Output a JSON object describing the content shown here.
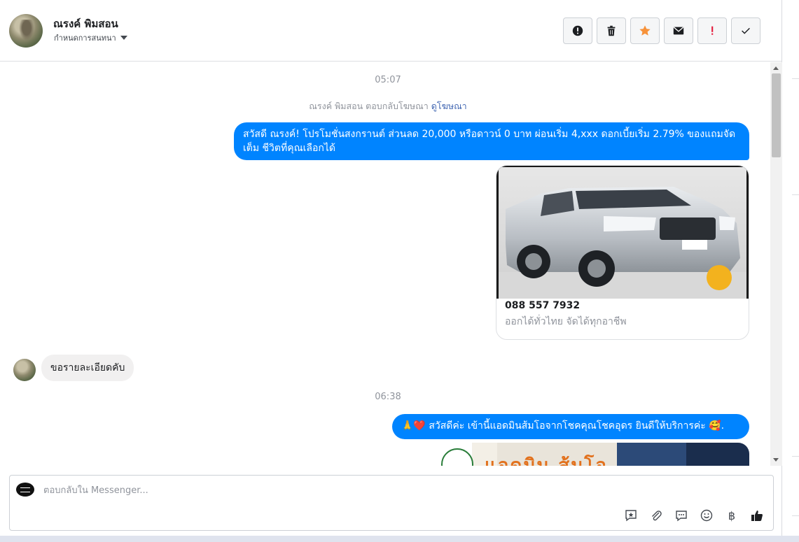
{
  "header": {
    "contact_name": "ณรงค์ พิมสอน",
    "conversation_status": "กำหนดการสนทนา",
    "toolbar_icons": [
      "alert-circle-icon",
      "trash-icon",
      "star-icon",
      "envelope-icon",
      "exclamation-icon",
      "check-icon"
    ]
  },
  "messages": {
    "timestamp_1": "05:07",
    "ad_note_text": "ณรงค์ พิมสอน ตอบกลับโฆษณา",
    "ad_note_link": "ดูโฆษณา",
    "outgoing_1": "สวัสดี ณรงค์! โปรโมชั่นสงกรานต์ ส่วนลด 20,000 หรือดาวน์ 0 บาท ผ่อนเริ่ม 4,xxx ดอกเบี้ยเริ่ม 2.79% ของแถมจัดเต็ม ชีวิตที่คุณเลือกได้",
    "card_phone": "088 557 7932",
    "card_subtitle": "ออกได้ทั่วไทย จัดได้ทุกอาชีพ",
    "incoming_1": "ขอรายละเอียดคับ",
    "timestamp_2": "06:38",
    "outgoing_2": "🙏❤️ สวัสดีค่ะ เข้านี้แอดมินส้มโอจากโชคคุณโชคอุดร ยินดีให้บริการค่ะ 🥰.",
    "banner_text": "แอดมิน ส้มโอ"
  },
  "composer": {
    "placeholder": "ตอบกลับใน Messenger...",
    "value": "",
    "tools": [
      "saved-reply-icon",
      "attachment-icon",
      "chat-bubble-icon",
      "emoji-icon",
      "baht-icon",
      "thumbs-up-icon"
    ],
    "baht_symbol": "฿"
  },
  "colors": {
    "outgoing_bubble": "#0084ff",
    "incoming_bubble": "#f1f0f0",
    "star": "#f7923a",
    "exclamation": "#e41e3f"
  }
}
